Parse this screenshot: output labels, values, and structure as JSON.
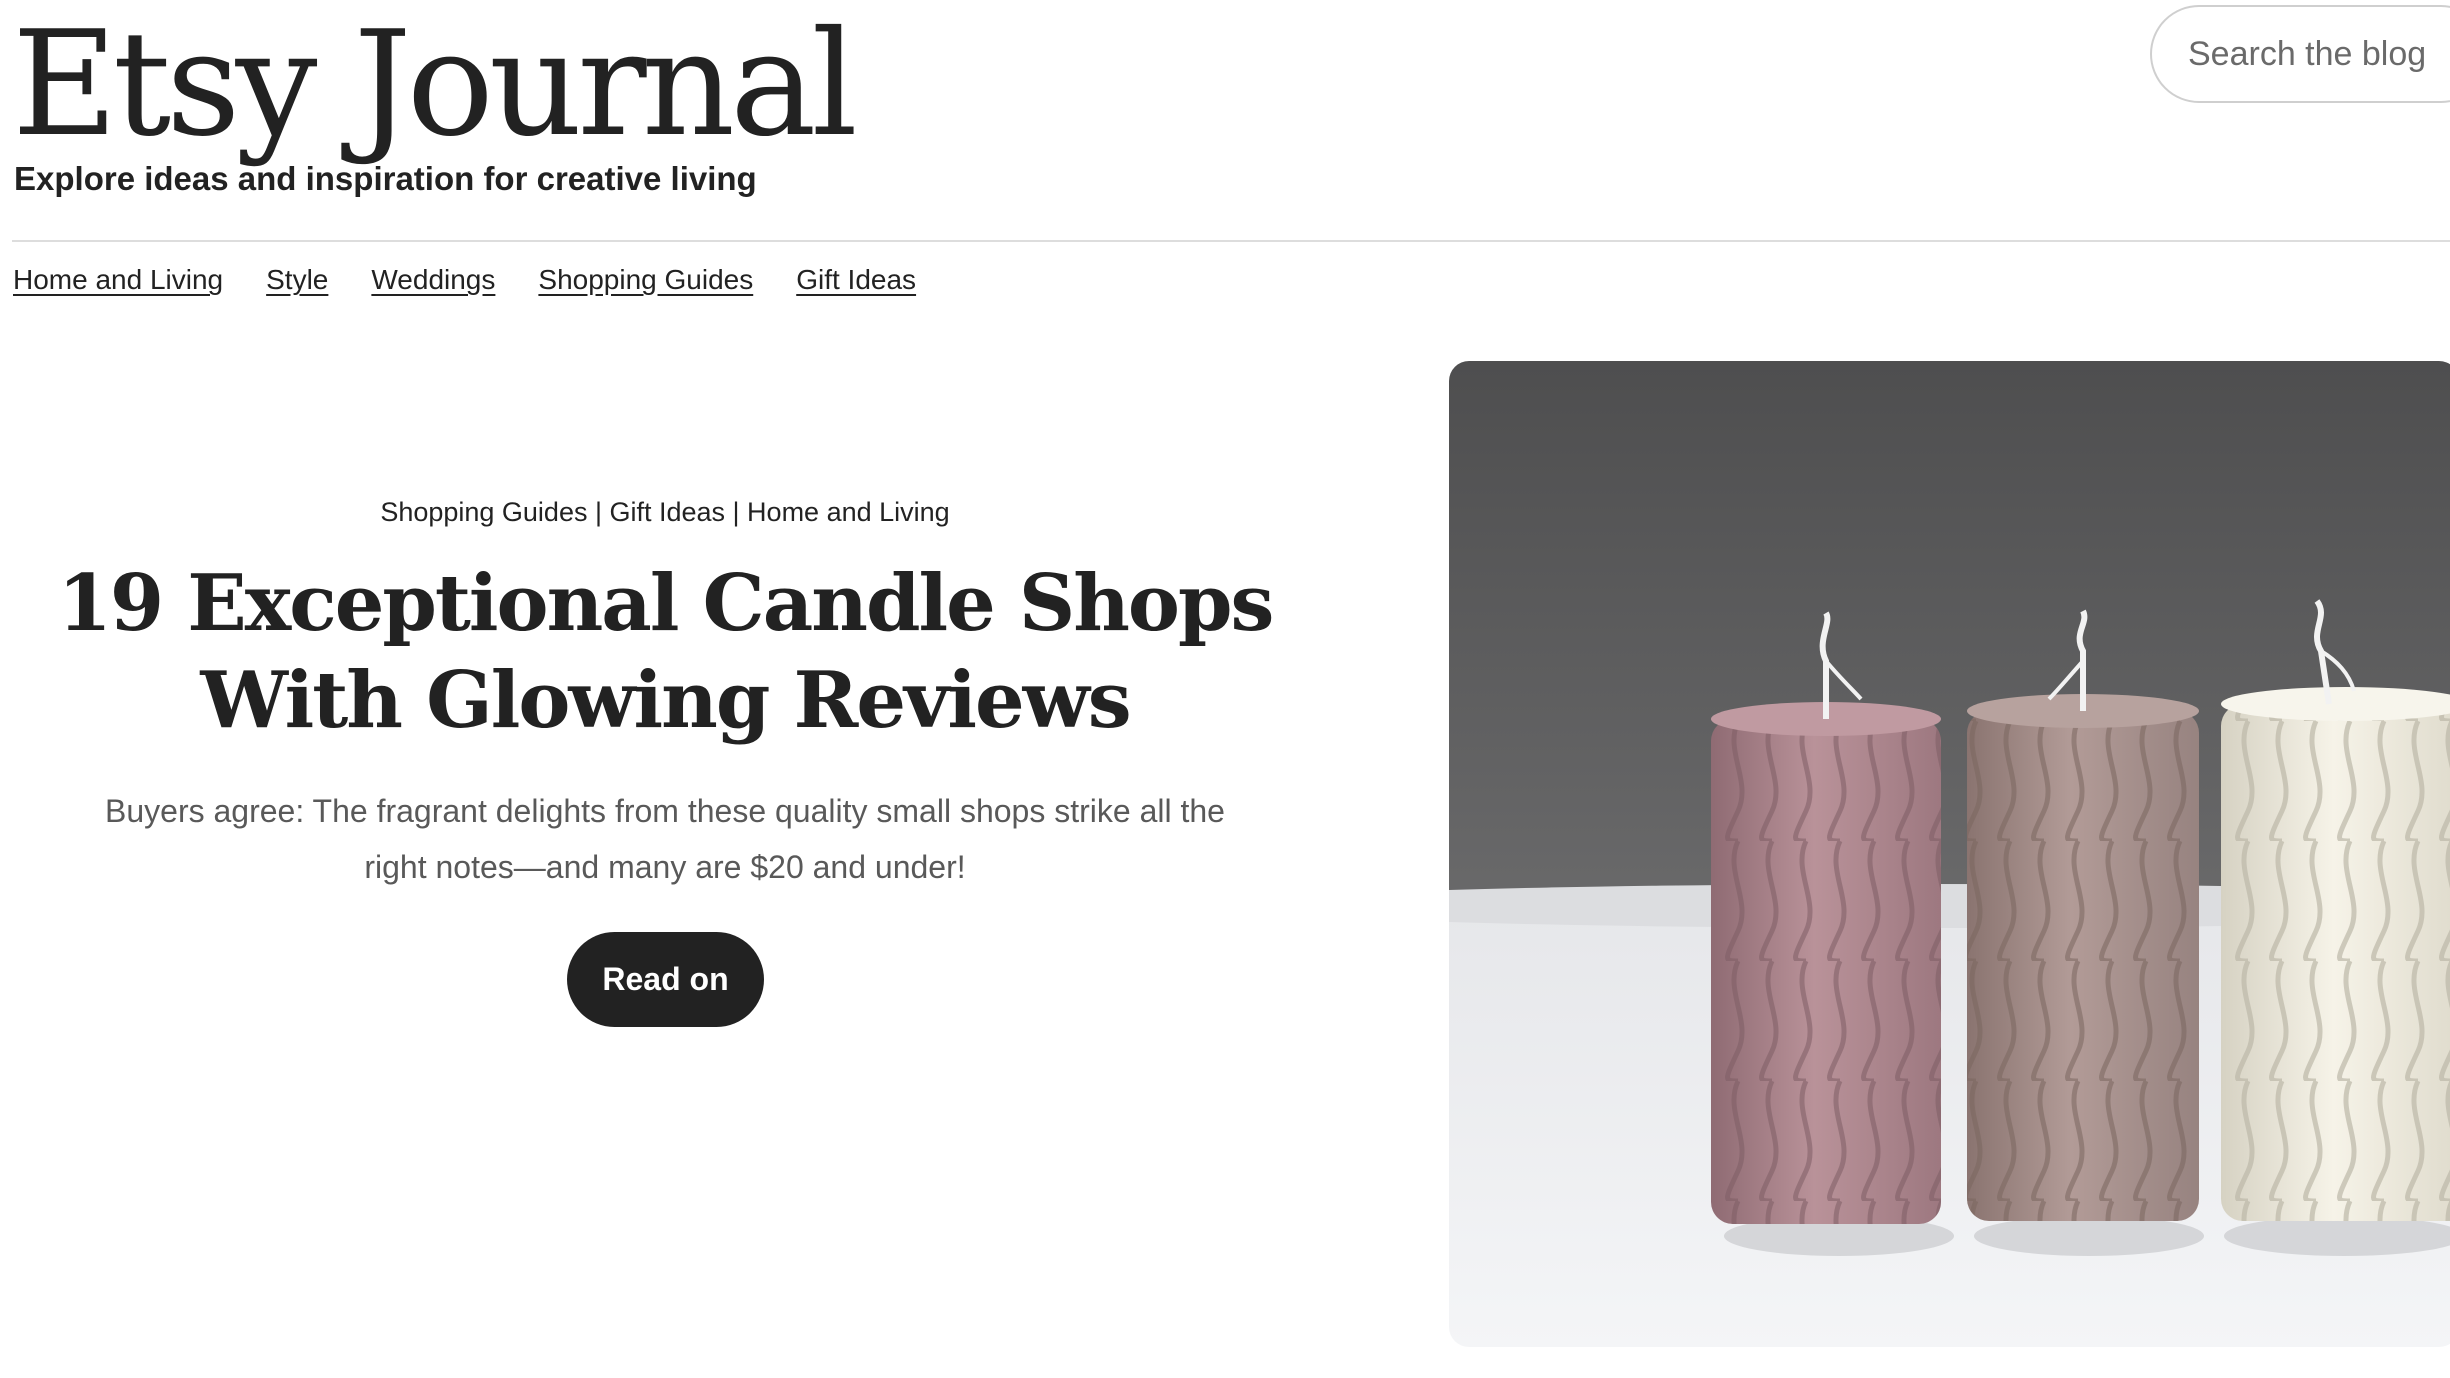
{
  "header": {
    "title": "Etsy Journal",
    "tagline": "Explore ideas and inspiration for creative living",
    "search": {
      "placeholder": "Search the blog"
    }
  },
  "nav": {
    "items": [
      {
        "label": "Home and Living"
      },
      {
        "label": "Style"
      },
      {
        "label": "Weddings"
      },
      {
        "label": "Shopping Guides"
      },
      {
        "label": "Gift Ideas"
      }
    ]
  },
  "featured": {
    "tags": "Shopping Guides | Gift Ideas | Home and Living",
    "title_line1": "19 Exceptional Candle Shops",
    "title_line2": "With Glowing Reviews",
    "summary_line1": "Buyers agree: The fragrant delights from these quality small shops strike all the",
    "summary_line2": "right notes—and many are $20 and under!",
    "button_label": "Read on",
    "image_icon": "twisted-pillar-candles-photo"
  },
  "colors": {
    "text": "#222222",
    "muted_text": "#595959",
    "button_bg": "#222222",
    "button_text": "#ffffff",
    "divider": "#dddddd",
    "candle_pink": "#b18a92",
    "candle_taupe": "#a8908c",
    "candle_cream": "#ece9dc"
  }
}
